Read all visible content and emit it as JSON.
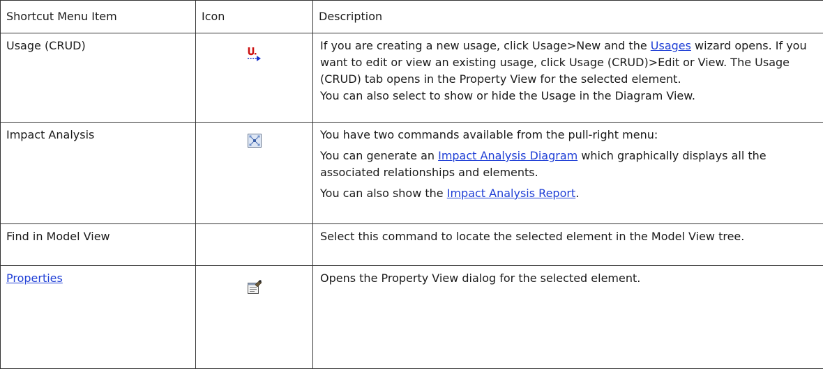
{
  "table": {
    "headers": {
      "item": "Shortcut  Menu Item",
      "icon": "Icon",
      "description": "Description"
    },
    "rows": [
      {
        "name": "Usage (CRUD)",
        "icon": "usage-crud-icon",
        "desc": {
          "pre": "If you are creating a new usage, click Usage>New and the ",
          "link": "Usages",
          "post": " wizard opens. If you want to edit or view an existing usage, click Usage (CRUD)>Edit or View. The Usage (CRUD) tab opens in the Property View for the selected element.",
          "line2": "You can also select to show or hide the Usage in the Diagram View."
        }
      },
      {
        "name": "Impact Analysis",
        "icon": "impact-analysis-icon",
        "desc": {
          "p1": "You have two commands available from the pull-right menu:",
          "p2_pre": "You can generate an ",
          "p2_link": "Impact Analysis Diagram",
          "p2_post": " which graphically displays all the associated relationships and elements.",
          "p3_pre": "You can also show the ",
          "p3_link": "Impact Analysis Report",
          "p3_post": "."
        }
      },
      {
        "name": "Find in Model View",
        "icon": "",
        "desc": {
          "text": "Select this command to locate the selected element in the Model View tree."
        }
      },
      {
        "name": "Properties",
        "icon": "properties-icon",
        "desc": {
          "text": "Opens the Property View dialog for the selected element."
        }
      }
    ]
  },
  "colors": {
    "link": "#1f3fd6",
    "usage_icon_red": "#cc1111",
    "usage_icon_blue": "#1a33cc",
    "border": "#333333"
  }
}
